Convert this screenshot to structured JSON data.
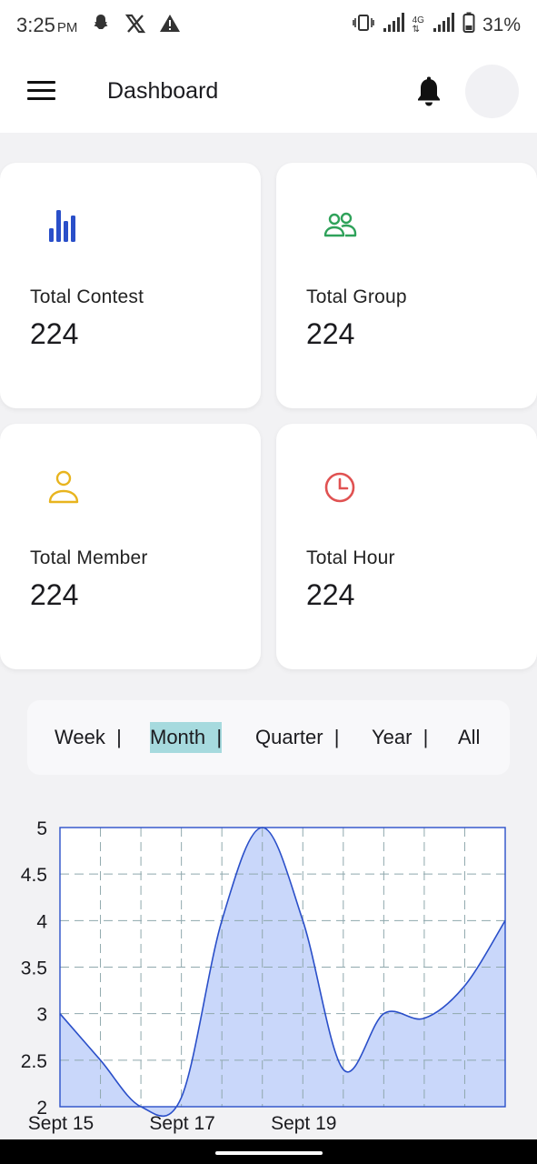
{
  "status_bar": {
    "time": "3:25",
    "ampm": "PM",
    "battery": "31%",
    "network": "4G"
  },
  "app_bar": {
    "title": "Dashboard"
  },
  "cards": [
    {
      "label": "Total Contest",
      "value": "224",
      "icon": "bar-chart-icon",
      "color": "#2a4fc9"
    },
    {
      "label": "Total Group",
      "value": "224",
      "icon": "group-icon",
      "color": "#2fa25a"
    },
    {
      "label": "Total Member",
      "value": "224",
      "icon": "person-icon",
      "color": "#e8b41e"
    },
    {
      "label": "Total Hour",
      "value": "224",
      "icon": "clock-icon",
      "color": "#e05252"
    }
  ],
  "periods": {
    "selected": "Month",
    "items": [
      "Week  |",
      "Month  |",
      "Quarter  |",
      "Year  |",
      "All"
    ]
  },
  "chart_data": {
    "type": "area",
    "x_tick_labels": [
      "Sept 15",
      "Sept 17",
      "Sept 19"
    ],
    "y_ticks": [
      "2",
      "2.5",
      "3",
      "3.5",
      "4",
      "4.5",
      "5"
    ],
    "ylim": [
      2,
      5
    ],
    "x": [
      0,
      1,
      2,
      3,
      4,
      5,
      6,
      7,
      8,
      9,
      10,
      11
    ],
    "values": [
      3.0,
      2.5,
      2.0,
      2.1,
      4.0,
      5.0,
      4.0,
      2.4,
      3.0,
      2.95,
      3.3,
      4.0
    ],
    "line_color": "#2a4fc9",
    "fill_color": "#c9d7fa",
    "grid": true,
    "grid_style": "dashed"
  }
}
